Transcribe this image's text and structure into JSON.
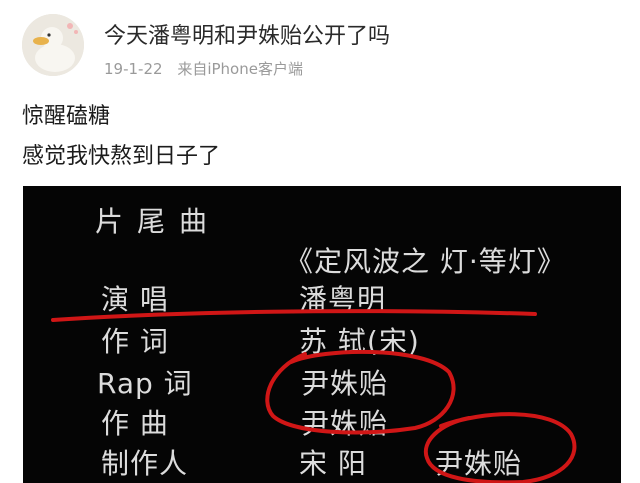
{
  "post": {
    "title": "今天潘粤明和尹姝贻公开了吗",
    "date": "19-1-22",
    "source": "来自iPhone客户端",
    "text_line1": "惊醒磕糖",
    "text_line2": "感觉我快熬到日子了"
  },
  "video": {
    "heading": "片尾曲",
    "song_title": "《定风波之 灯·等灯》",
    "credits": [
      {
        "role": "演 唱",
        "name": "潘粤明"
      },
      {
        "role": "作 词",
        "name": "苏 轼(宋)"
      },
      {
        "role": "Rap 词",
        "name": "尹姝贻"
      },
      {
        "role": "作 曲",
        "name": "尹姝贻"
      },
      {
        "role": "制作人",
        "name": "宋 阳",
        "extra": "尹姝贻"
      }
    ]
  },
  "colors": {
    "annotation": "#d01616",
    "credit_text": "#dcdcdc",
    "background": "#050505"
  }
}
